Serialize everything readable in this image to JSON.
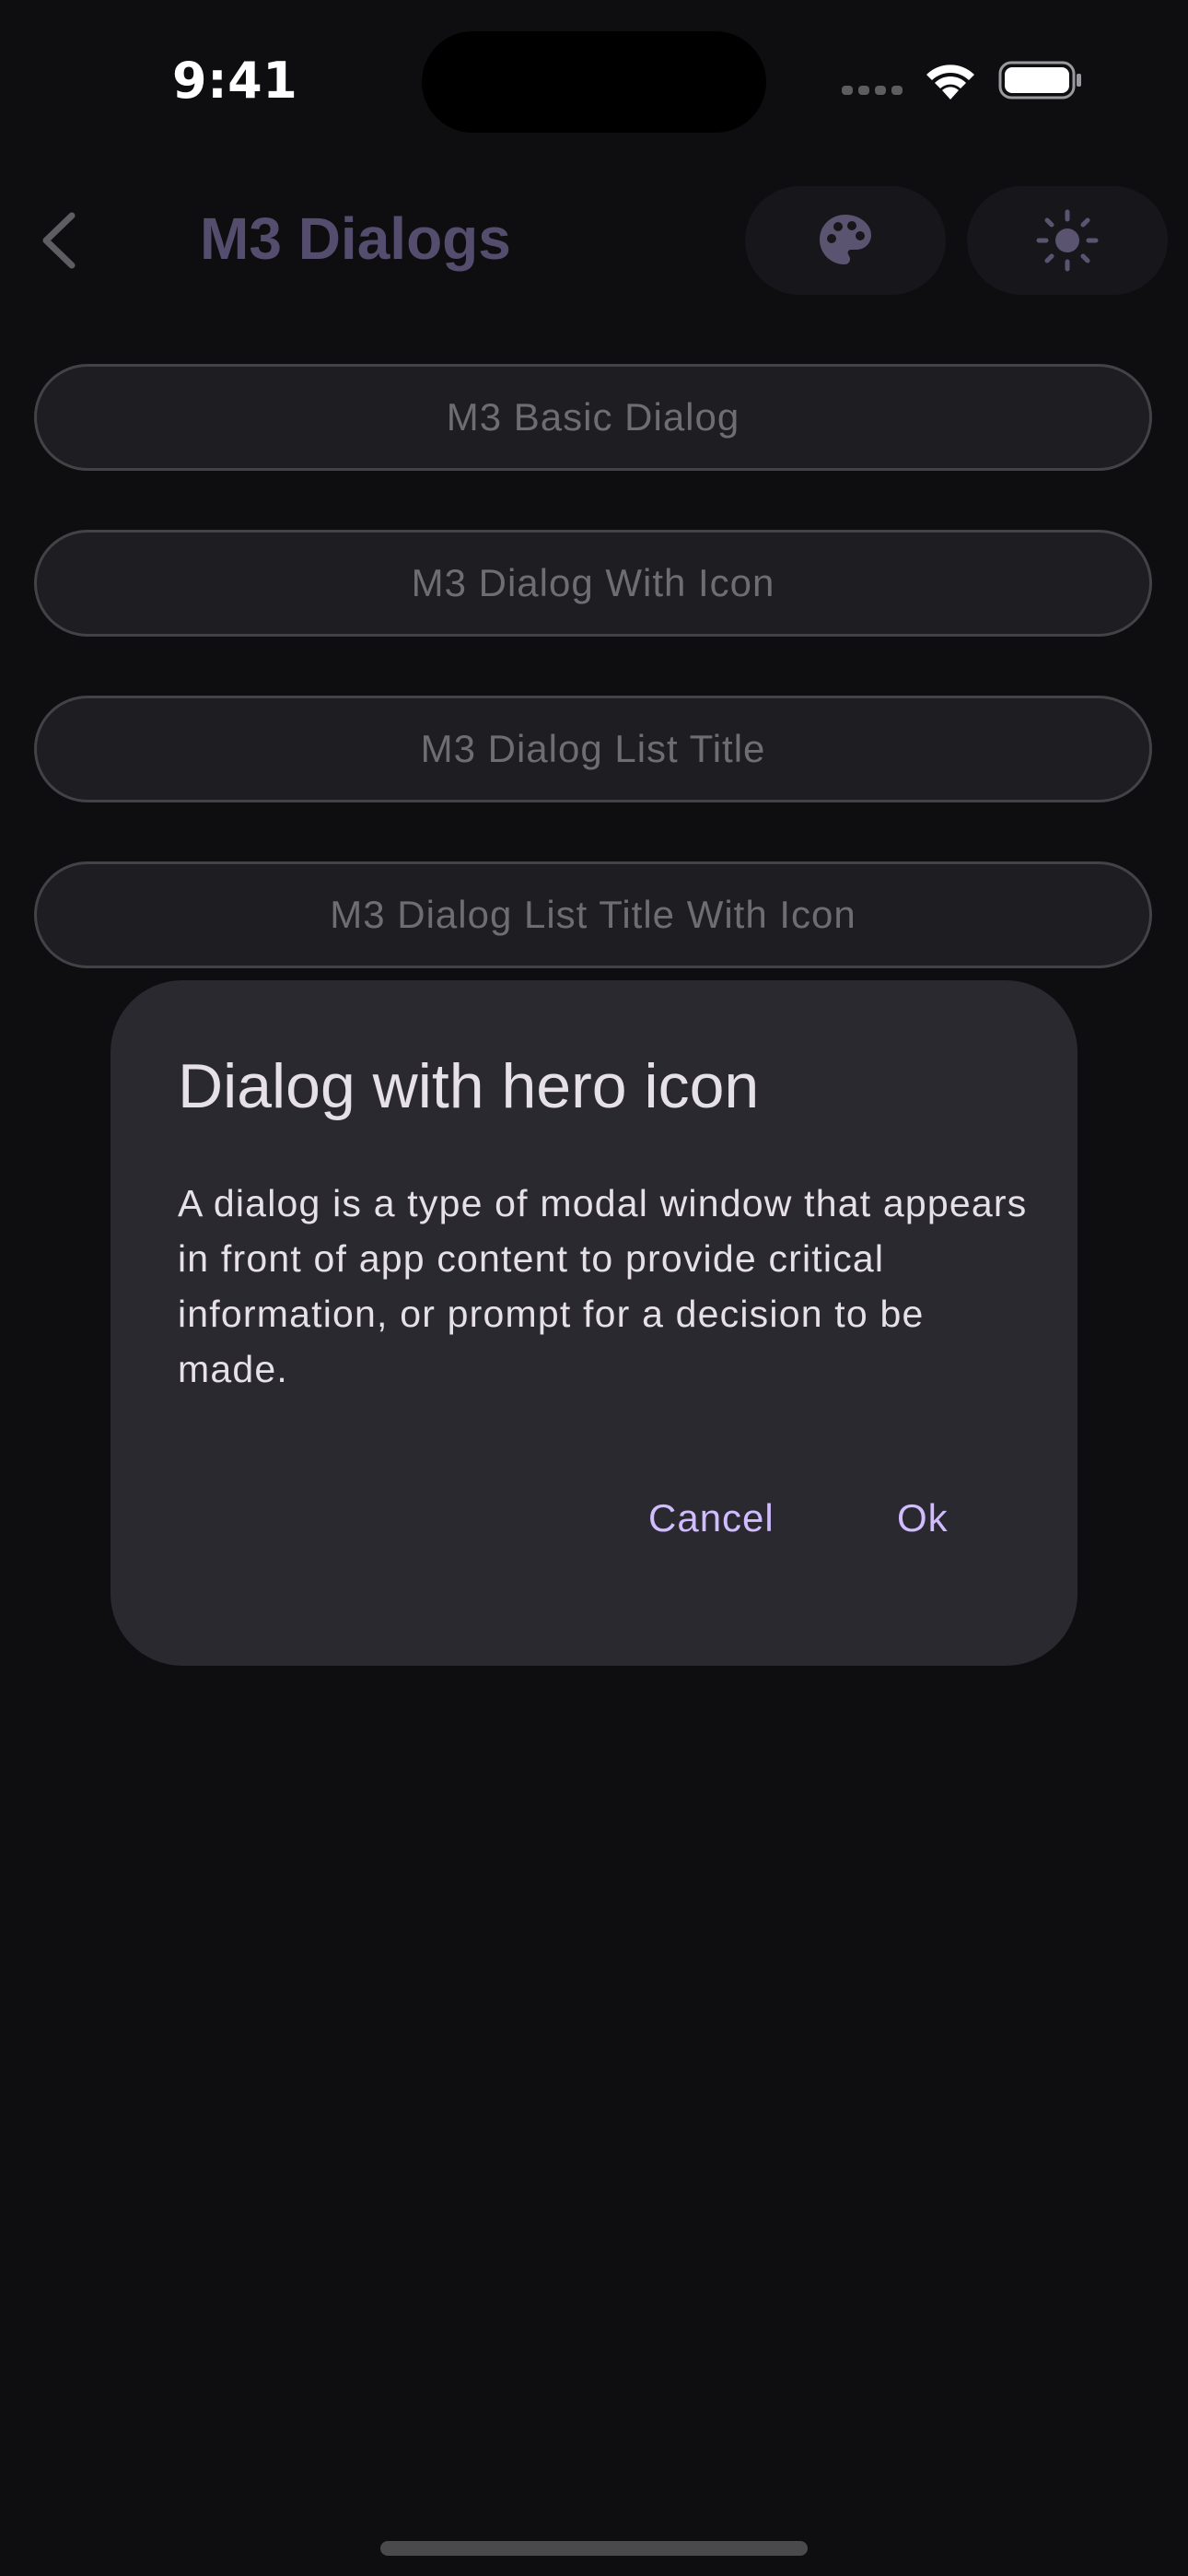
{
  "status_bar": {
    "time": "9:41"
  },
  "app_bar": {
    "title": "M3 Dialogs",
    "icons": [
      "back-icon",
      "palette-icon",
      "brightness-icon"
    ]
  },
  "buttons": [
    {
      "label": "M3 Basic Dialog"
    },
    {
      "label": "M3 Dialog With Icon"
    },
    {
      "label": "M3 Dialog List Title"
    },
    {
      "label": "M3 Dialog List Title With Icon"
    }
  ],
  "dialog": {
    "title": "Dialog with hero icon",
    "body": "A dialog is a type of modal window that appears in front of app content to provide critical information, or prompt for a decision to be made.",
    "cancel_label": "Cancel",
    "ok_label": "Ok"
  },
  "colors": {
    "background": "#0e0e10",
    "dialog_surface": "#2b2930",
    "accent": "#d0bcff",
    "on_surface": "#e6e0e9"
  }
}
